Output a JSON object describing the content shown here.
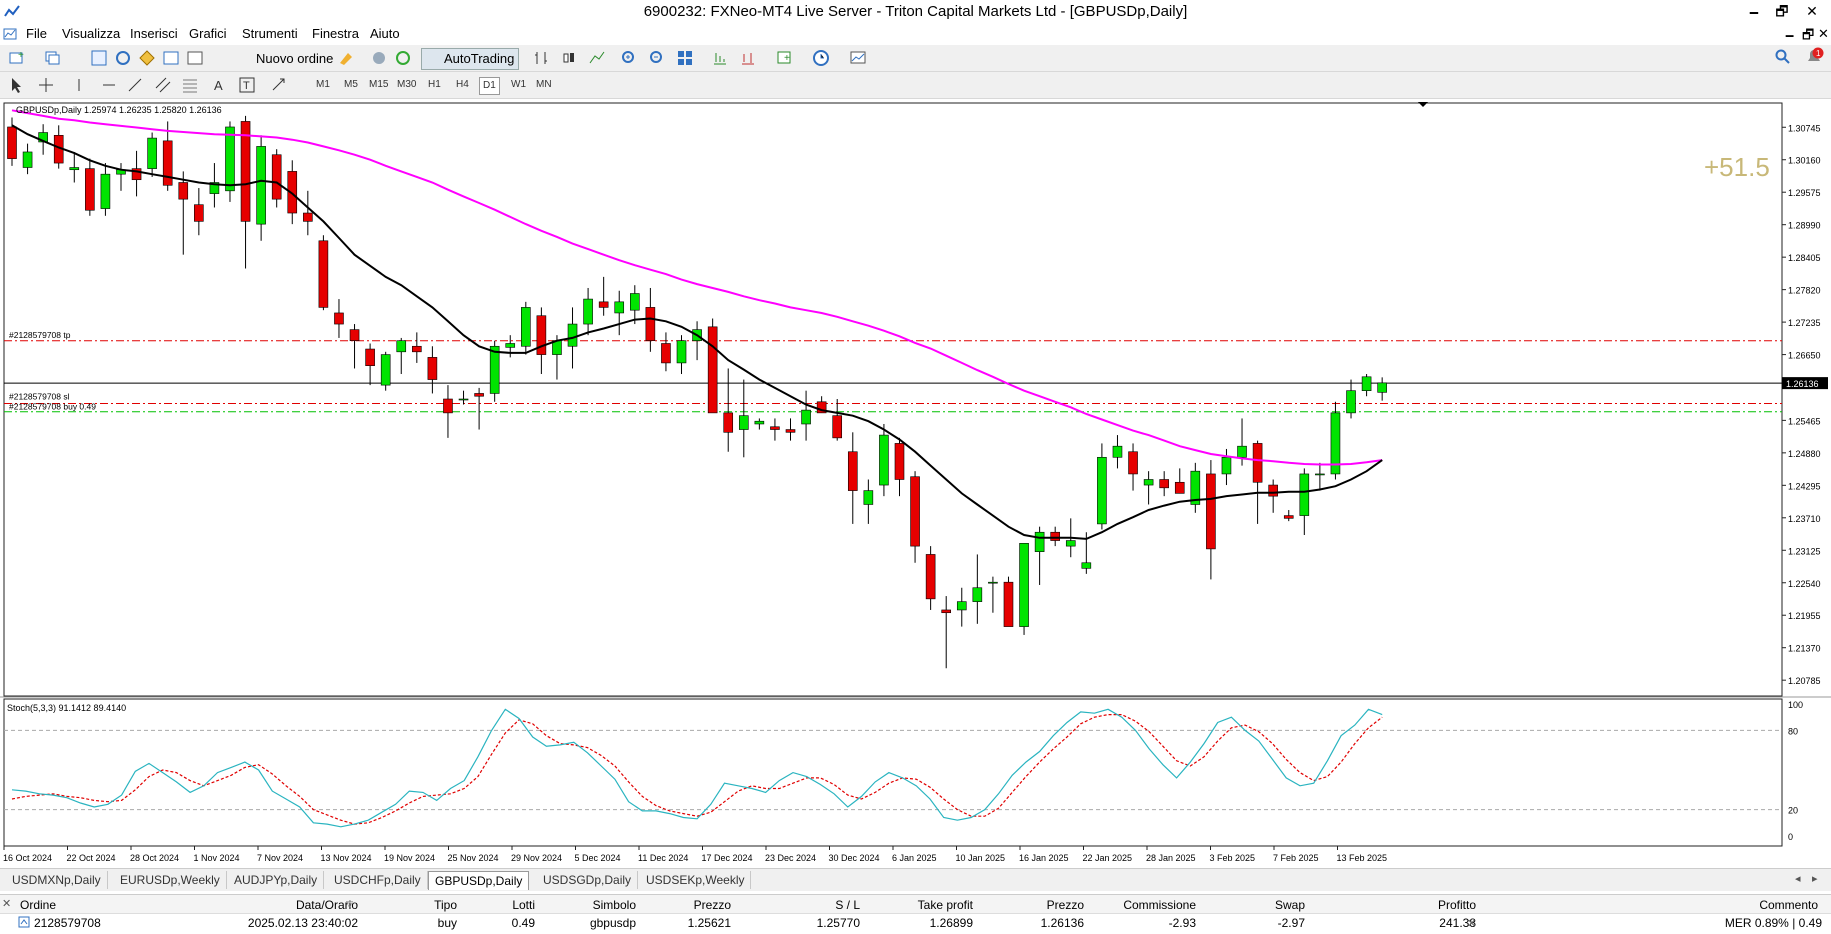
{
  "window": {
    "title": "6900232: FXNeo-MT4 Live Server - Triton Capital Markets Ltd - [GBPUSDp,Daily]",
    "min": "🗕",
    "max": "🗗",
    "close": "✕"
  },
  "menu": [
    "File",
    "Visualizza",
    "Inserisci",
    "Grafici",
    "Strumenti",
    "Finestra",
    "Aiuto"
  ],
  "toolbar": {
    "new_order": "Nuovo ordine",
    "autotrading": "AutoTrading"
  },
  "timeframes": [
    "M1",
    "M5",
    "M15",
    "M30",
    "H1",
    "H4",
    "D1",
    "W1",
    "MN"
  ],
  "active_timeframe": "D1",
  "chart": {
    "header": "GBPUSDp,Daily  1.25974 1.26235 1.25820 1.26136",
    "tp_label": "#2128579708 tp",
    "sl_label": "#2128579708 sl",
    "buy_label": "#2128579708 buy 0.49",
    "profit_points": "+51.5",
    "current_price": "1.26136",
    "stoch_header": "Stoch(5,3,3) 91.1412 89.4140",
    "colors": {
      "up": "#00e400",
      "down": "#e60000",
      "ma_fast": "#000000",
      "ma_slow": "#ff00ff",
      "stoch_main": "#2ab4c0",
      "stoch_signal": "#e00000",
      "tp_line": "#e00000",
      "sl_line": "#e00000",
      "buy_line": "#00c000",
      "profit_text": "#c8b878"
    }
  },
  "chart_data": [
    {
      "type": "candlestick",
      "title": "GBPUSDp,Daily",
      "ylim": [
        1.205,
        1.312
      ],
      "y_ticks": [
        "1.30745",
        "1.30160",
        "1.29575",
        "1.28990",
        "1.28405",
        "1.27820",
        "1.27235",
        "1.26650",
        "1.26136",
        "1.25465",
        "1.24880",
        "1.24295",
        "1.23710",
        "1.23125",
        "1.22540",
        "1.21955",
        "1.21370",
        "1.20785"
      ],
      "x_ticks": [
        "16 Oct 2024",
        "22 Oct 2024",
        "28 Oct 2024",
        "1 Nov 2024",
        "7 Nov 2024",
        "13 Nov 2024",
        "19 Nov 2024",
        "25 Nov 2024",
        "29 Nov 2024",
        "5 Dec 2024",
        "11 Dec 2024",
        "17 Dec 2024",
        "23 Dec 2024",
        "30 Dec 2024",
        "6 Jan 2025",
        "10 Jan 2025",
        "16 Jan 2025",
        "22 Jan 2025",
        "28 Jan 2025",
        "3 Feb 2025",
        "7 Feb 2025",
        "13 Feb 2025"
      ],
      "levels": {
        "tp": 1.26899,
        "sl": 1.2577,
        "open": 1.25621,
        "bid": 1.26136
      },
      "ohlc": [
        [
          1.3075,
          1.3092,
          1.3005,
          1.3018
        ],
        [
          1.3002,
          1.3045,
          1.299,
          1.303
        ],
        [
          1.3048,
          1.308,
          1.3025,
          1.3065
        ],
        [
          1.306,
          1.3078,
          1.3,
          1.301
        ],
        [
          1.2998,
          1.303,
          1.2975,
          1.3002
        ],
        [
          1.3,
          1.3018,
          1.2915,
          1.2925
        ],
        [
          1.2928,
          1.301,
          1.2915,
          1.299
        ],
        [
          1.299,
          1.301,
          1.296,
          1.2998
        ],
        [
          1.3,
          1.3032,
          1.295,
          1.298
        ],
        [
          1.3,
          1.3065,
          1.2985,
          1.3055
        ],
        [
          1.305,
          1.3085,
          1.296,
          1.297
        ],
        [
          1.2975,
          1.2995,
          1.2845,
          1.2945
        ],
        [
          1.2935,
          1.2965,
          1.288,
          1.2905
        ],
        [
          1.2955,
          1.301,
          1.293,
          1.2975
        ],
        [
          1.296,
          1.3085,
          1.294,
          1.3075
        ],
        [
          1.3085,
          1.3095,
          1.282,
          1.2905
        ],
        [
          1.29,
          1.306,
          1.287,
          1.304
        ],
        [
          1.3025,
          1.3035,
          1.293,
          1.2945
        ],
        [
          1.2995,
          1.3015,
          1.29,
          1.292
        ],
        [
          1.292,
          1.296,
          1.288,
          1.2905
        ],
        [
          1.287,
          1.288,
          1.2745,
          1.275
        ],
        [
          1.274,
          1.2765,
          1.2695,
          1.272
        ],
        [
          1.271,
          1.272,
          1.264,
          1.269
        ],
        [
          1.2675,
          1.2685,
          1.261,
          1.2645
        ],
        [
          1.261,
          1.267,
          1.26,
          1.2665
        ],
        [
          1.267,
          1.2695,
          1.263,
          1.269
        ],
        [
          1.268,
          1.2705,
          1.265,
          1.267
        ],
        [
          1.266,
          1.268,
          1.2595,
          1.262
        ],
        [
          1.2585,
          1.261,
          1.2515,
          1.256
        ],
        [
          1.2585,
          1.26,
          1.2575,
          1.2585
        ],
        [
          1.2595,
          1.2605,
          1.253,
          1.259
        ],
        [
          1.2595,
          1.269,
          1.258,
          1.268
        ],
        [
          1.2678,
          1.27,
          1.266,
          1.2685
        ],
        [
          1.268,
          1.276,
          1.2665,
          1.275
        ],
        [
          1.2735,
          1.275,
          1.263,
          1.2665
        ],
        [
          1.2665,
          1.27,
          1.262,
          1.269
        ],
        [
          1.268,
          1.275,
          1.264,
          1.272
        ],
        [
          1.272,
          1.2785,
          1.27,
          1.2765
        ],
        [
          1.276,
          1.2805,
          1.2735,
          1.275
        ],
        [
          1.274,
          1.278,
          1.27,
          1.276
        ],
        [
          1.2745,
          1.279,
          1.272,
          1.2775
        ],
        [
          1.275,
          1.2785,
          1.267,
          1.269
        ],
        [
          1.2685,
          1.2705,
          1.2635,
          1.265
        ],
        [
          1.265,
          1.27,
          1.263,
          1.269
        ],
        [
          1.269,
          1.2725,
          1.2655,
          1.271
        ],
        [
          1.2715,
          1.273,
          1.2615,
          1.256
        ],
        [
          1.256,
          1.264,
          1.249,
          1.2525
        ],
        [
          1.253,
          1.262,
          1.248,
          1.2555
        ],
        [
          1.254,
          1.255,
          1.253,
          1.2545
        ],
        [
          1.2535,
          1.255,
          1.251,
          1.253
        ],
        [
          1.253,
          1.255,
          1.251,
          1.2525
        ],
        [
          1.254,
          1.26,
          1.251,
          1.2565
        ],
        [
          1.258,
          1.259,
          1.256,
          1.256
        ],
        [
          1.2555,
          1.2585,
          1.251,
          1.2515
        ],
        [
          1.249,
          1.2525,
          1.236,
          1.242
        ],
        [
          1.2395,
          1.244,
          1.236,
          1.242
        ],
        [
          1.243,
          1.254,
          1.241,
          1.252
        ],
        [
          1.2505,
          1.2515,
          1.241,
          1.244
        ],
        [
          1.2445,
          1.2455,
          1.229,
          1.232
        ],
        [
          1.2305,
          1.232,
          1.2205,
          1.2225
        ],
        [
          1.2205,
          1.223,
          1.21,
          1.22
        ],
        [
          1.2205,
          1.2245,
          1.2175,
          1.222
        ],
        [
          1.222,
          1.2305,
          1.218,
          1.2245
        ],
        [
          1.2255,
          1.2265,
          1.22,
          1.2255
        ],
        [
          1.2255,
          1.2265,
          1.218,
          1.2175
        ],
        [
          1.2175,
          1.231,
          1.216,
          1.2325
        ],
        [
          1.231,
          1.2355,
          1.225,
          1.2345
        ],
        [
          1.2345,
          1.2355,
          1.232,
          1.233
        ],
        [
          1.232,
          1.237,
          1.23,
          1.233
        ],
        [
          1.228,
          1.2345,
          1.227,
          1.229
        ],
        [
          1.236,
          1.2505,
          1.235,
          1.248
        ],
        [
          1.248,
          1.252,
          1.246,
          1.25
        ],
        [
          1.249,
          1.2505,
          1.242,
          1.245
        ],
        [
          1.243,
          1.2455,
          1.2395,
          1.244
        ],
        [
          1.244,
          1.2455,
          1.241,
          1.2425
        ],
        [
          1.2435,
          1.246,
          1.2415,
          1.2415
        ],
        [
          1.2395,
          1.247,
          1.238,
          1.2455
        ],
        [
          1.245,
          1.2475,
          1.226,
          1.2315
        ],
        [
          1.245,
          1.2495,
          1.243,
          1.248
        ],
        [
          1.248,
          1.255,
          1.2465,
          1.25
        ],
        [
          1.2505,
          1.251,
          1.236,
          1.2435
        ],
        [
          1.243,
          1.244,
          1.238,
          1.241
        ],
        [
          1.2375,
          1.2385,
          1.2365,
          1.237
        ],
        [
          1.2375,
          1.246,
          1.234,
          1.245
        ],
        [
          1.245,
          1.247,
          1.242,
          1.245
        ],
        [
          1.245,
          1.258,
          1.244,
          1.256
        ],
        [
          1.256,
          1.262,
          1.255,
          1.26
        ],
        [
          1.26,
          1.263,
          1.259,
          1.2625
        ],
        [
          1.2597,
          1.2624,
          1.2582,
          1.2614
        ]
      ],
      "ma_fast": [
        1.3078,
        1.3062,
        1.305,
        1.3038,
        1.3028,
        1.3015,
        1.3005,
        1.2998,
        1.2995,
        1.299,
        1.2985,
        1.298,
        1.2975,
        1.2972,
        1.297,
        1.2972,
        1.2978,
        1.2975,
        1.2955,
        1.293,
        1.2905,
        1.2875,
        1.2845,
        1.2825,
        1.2805,
        1.279,
        1.277,
        1.275,
        1.2725,
        1.27,
        1.268,
        1.267,
        1.2668,
        1.2668,
        1.268,
        1.269,
        1.2695,
        1.2705,
        1.2712,
        1.272,
        1.2728,
        1.273,
        1.2725,
        1.2715,
        1.27,
        1.268,
        1.2655,
        1.2638,
        1.262,
        1.2605,
        1.259,
        1.2575,
        1.2565,
        1.256,
        1.2555,
        1.2545,
        1.253,
        1.2512,
        1.249,
        1.2465,
        1.244,
        1.2415,
        1.2395,
        1.2375,
        1.2355,
        1.234,
        1.2335,
        1.2335,
        1.2335,
        1.2333,
        1.2345,
        1.236,
        1.2372,
        1.2385,
        1.2393,
        1.24,
        1.2403,
        1.2405,
        1.241,
        1.2413,
        1.2416,
        1.2416,
        1.2418,
        1.2418,
        1.2422,
        1.2428,
        1.244,
        1.2455,
        1.2475
      ],
      "ma_slow": [
        1.3105,
        1.31,
        1.3095,
        1.309,
        1.3087,
        1.3083,
        1.308,
        1.3077,
        1.3074,
        1.3071,
        1.3068,
        1.3066,
        1.3064,
        1.3062,
        1.3061,
        1.306,
        1.3058,
        1.3056,
        1.3052,
        1.3047,
        1.304,
        1.3033,
        1.3025,
        1.3016,
        1.3005,
        1.2995,
        1.2985,
        1.2975,
        1.2962,
        1.295,
        1.2938,
        1.2926,
        1.2913,
        1.29,
        1.2888,
        1.2877,
        1.2865,
        1.2855,
        1.2845,
        1.2835,
        1.2826,
        1.2818,
        1.281,
        1.28,
        1.2792,
        1.2785,
        1.2778,
        1.277,
        1.2763,
        1.2757,
        1.275,
        1.2745,
        1.274,
        1.2733,
        1.2725,
        1.2717,
        1.2708,
        1.2698,
        1.2686,
        1.2676,
        1.2663,
        1.265,
        1.2637,
        1.2625,
        1.2612,
        1.26,
        1.259,
        1.258,
        1.257,
        1.2558,
        1.2548,
        1.2538,
        1.2528,
        1.252,
        1.251,
        1.25,
        1.2493,
        1.2486,
        1.2482,
        1.2478,
        1.2475,
        1.2473,
        1.247,
        1.2468,
        1.2467,
        1.2467,
        1.2468,
        1.2471,
        1.2475
      ]
    },
    {
      "type": "line",
      "title": "Stoch(5,3,3) 91.1412 89.4140",
      "ylim": [
        0,
        100
      ],
      "y_ticks": [
        "100",
        "80",
        "20",
        "0"
      ],
      "series": [
        {
          "name": "Main",
          "values": [
            35,
            34,
            32,
            31,
            29,
            25,
            22,
            24,
            31,
            49,
            55,
            48,
            41,
            33,
            38,
            48,
            52,
            56,
            50,
            34,
            28,
            22,
            10,
            9,
            7,
            9,
            12,
            18,
            24,
            34,
            33,
            27,
            36,
            42,
            60,
            80,
            96,
            89,
            75,
            68,
            69,
            71,
            63,
            53,
            43,
            26,
            19,
            19,
            17,
            14,
            13,
            24,
            40,
            38,
            36,
            33,
            42,
            48,
            45,
            39,
            32,
            22,
            30,
            41,
            48,
            44,
            38,
            28,
            14,
            12,
            14,
            20,
            32,
            46,
            56,
            64,
            76,
            86,
            94,
            93,
            96,
            90,
            80,
            66,
            54,
            44,
            56,
            70,
            86,
            90,
            80,
            72,
            58,
            44,
            38,
            40,
            57,
            76,
            84,
            96,
            92
          ]
        },
        {
          "name": "Signal",
          "values": [
            28,
            30,
            31,
            32,
            30,
            29,
            27,
            26,
            27,
            35,
            45,
            50,
            48,
            42,
            38,
            42,
            46,
            52,
            54,
            47,
            38,
            30,
            20,
            16,
            12,
            9,
            10,
            14,
            19,
            25,
            30,
            31,
            32,
            36,
            45,
            62,
            78,
            88,
            85,
            76,
            70,
            69,
            67,
            61,
            53,
            41,
            30,
            23,
            19,
            17,
            15,
            18,
            26,
            34,
            38,
            36,
            36,
            40,
            44,
            44,
            39,
            31,
            28,
            33,
            40,
            44,
            43,
            37,
            28,
            20,
            15,
            15,
            21,
            33,
            45,
            56,
            66,
            75,
            85,
            90,
            92,
            92,
            87,
            79,
            68,
            57,
            53,
            60,
            72,
            82,
            84,
            79,
            70,
            58,
            48,
            42,
            45,
            56,
            70,
            82,
            90
          ]
        }
      ]
    }
  ],
  "tabs": [
    "USDMXNp,Daily",
    "EURUSDp,Weekly",
    "AUDJPYp,Daily",
    "USDCHFp,Daily",
    "GBPUSDp,Daily",
    "USDSGDp,Daily",
    "USDSEKp,Weekly"
  ],
  "active_tab": "GBPUSDp,Daily",
  "terminal": {
    "headers": {
      "order": "Ordine",
      "time": "Data/Orario",
      "type": "Tipo",
      "lots": "Lotti",
      "symbol": "Simbolo",
      "price": "Prezzo",
      "sl": "S / L",
      "tp": "Take profit",
      "price2": "Prezzo",
      "commission": "Commissione",
      "swap": "Swap",
      "profit": "Profitto",
      "comment": "Commento"
    },
    "row": {
      "order": "2128579708",
      "time": "2025.02.13 23:40:02",
      "type": "buy",
      "lots": "0.49",
      "symbol": "gbpusdp",
      "price": "1.25621",
      "sl": "1.25770",
      "tp": "1.26899",
      "price2": "1.26136",
      "commission": "-2.93",
      "swap": "-2.97",
      "profit": "241.38",
      "comment": "MER 0.89% | 0.49"
    }
  }
}
